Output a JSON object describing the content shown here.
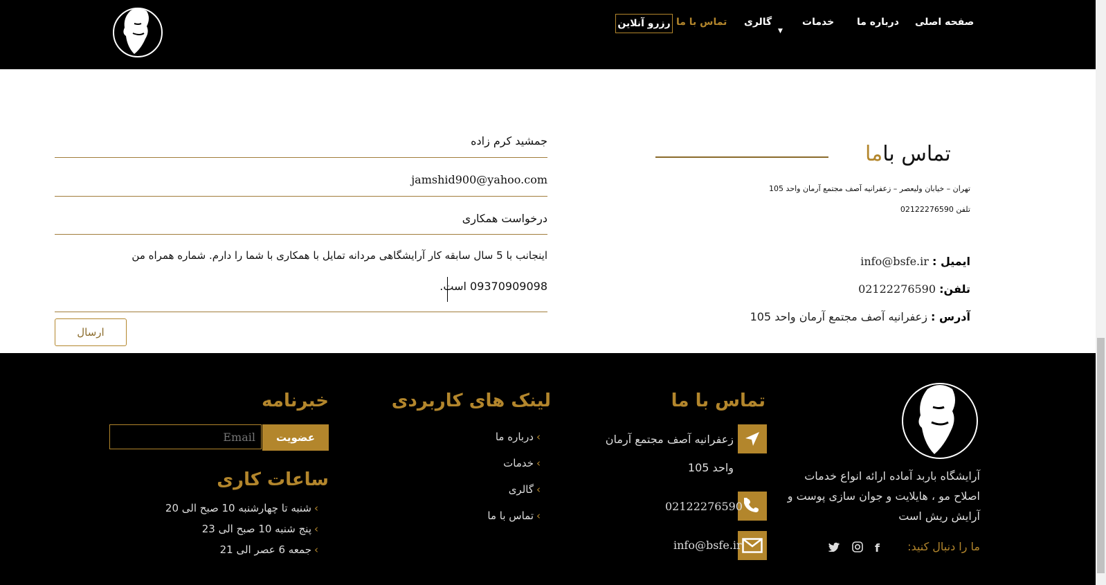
{
  "header": {
    "nav": {
      "home": "صفحه اصلی",
      "about": "درباره ما",
      "services": "خدمات",
      "gallery": "گالری",
      "contact": "تماس با ما",
      "reserve": "رزرو آنلاین"
    }
  },
  "form": {
    "name_value": "جمشید کرم زاده",
    "email_value": "jamshid900@yahoo.com",
    "subject_value": "درخواست همکاری",
    "message_line1": "اینجانب با 5 سال سابقه کار آرایشگاهی مردانه تمایل با همکاری با شما را دارم. شماره همراه من",
    "message_line2": "09370909098 است.",
    "submit_label": "ارسال"
  },
  "contact": {
    "title_dark": "تماس با",
    "title_gold": "ما",
    "address_line": "تهران – خیابان ولیعصر – زعفرانیه آصف مجتمع آرمان واحد 105",
    "phone_line": "تلفن 02122276590",
    "email_label": "ایمیل :",
    "email_value": "info@bsfe.ir",
    "phone_label": "تلفن:",
    "phone_value": "02122276590",
    "address_label": "آدرس :",
    "address_value": "زعفرانیه آصف مجتمع آرمان واحد 105"
  },
  "footer": {
    "about_text_1": "آرایشگاه باربد آماده ارائه انواع خدمات",
    "about_text_2": "اصلاح مو ، هایلایت و جوان سازی پوست و",
    "about_text_3": "آرایش ریش است",
    "follow_label": "ما را دنبال کنید:",
    "contact_title": "تماس با ما",
    "address_1": "زعفرانیه آصف مجتمع آرمان",
    "address_2": "واحد 105",
    "phone": "02122276590",
    "email": "info@bsfe.ir",
    "links_title": "لینک های کاربردی",
    "links": [
      "درباره ما",
      "خدمات",
      "گالری",
      "تماس با ما"
    ],
    "newsletter_title": "خبرنامه",
    "newsletter_placeholder": "Email",
    "subscribe_label": "عضویت",
    "hours_title": "ساعات کاری",
    "hours": [
      "شنبه تا چهارشنبه 10 صبح الی 20",
      "پنج شنبه 10 صبح الی 23",
      "جمعه 6 عصر الی 21"
    ]
  },
  "colors": {
    "accent": "#b3862c",
    "header_bg": "#000000",
    "footer_bg": "#000000"
  }
}
